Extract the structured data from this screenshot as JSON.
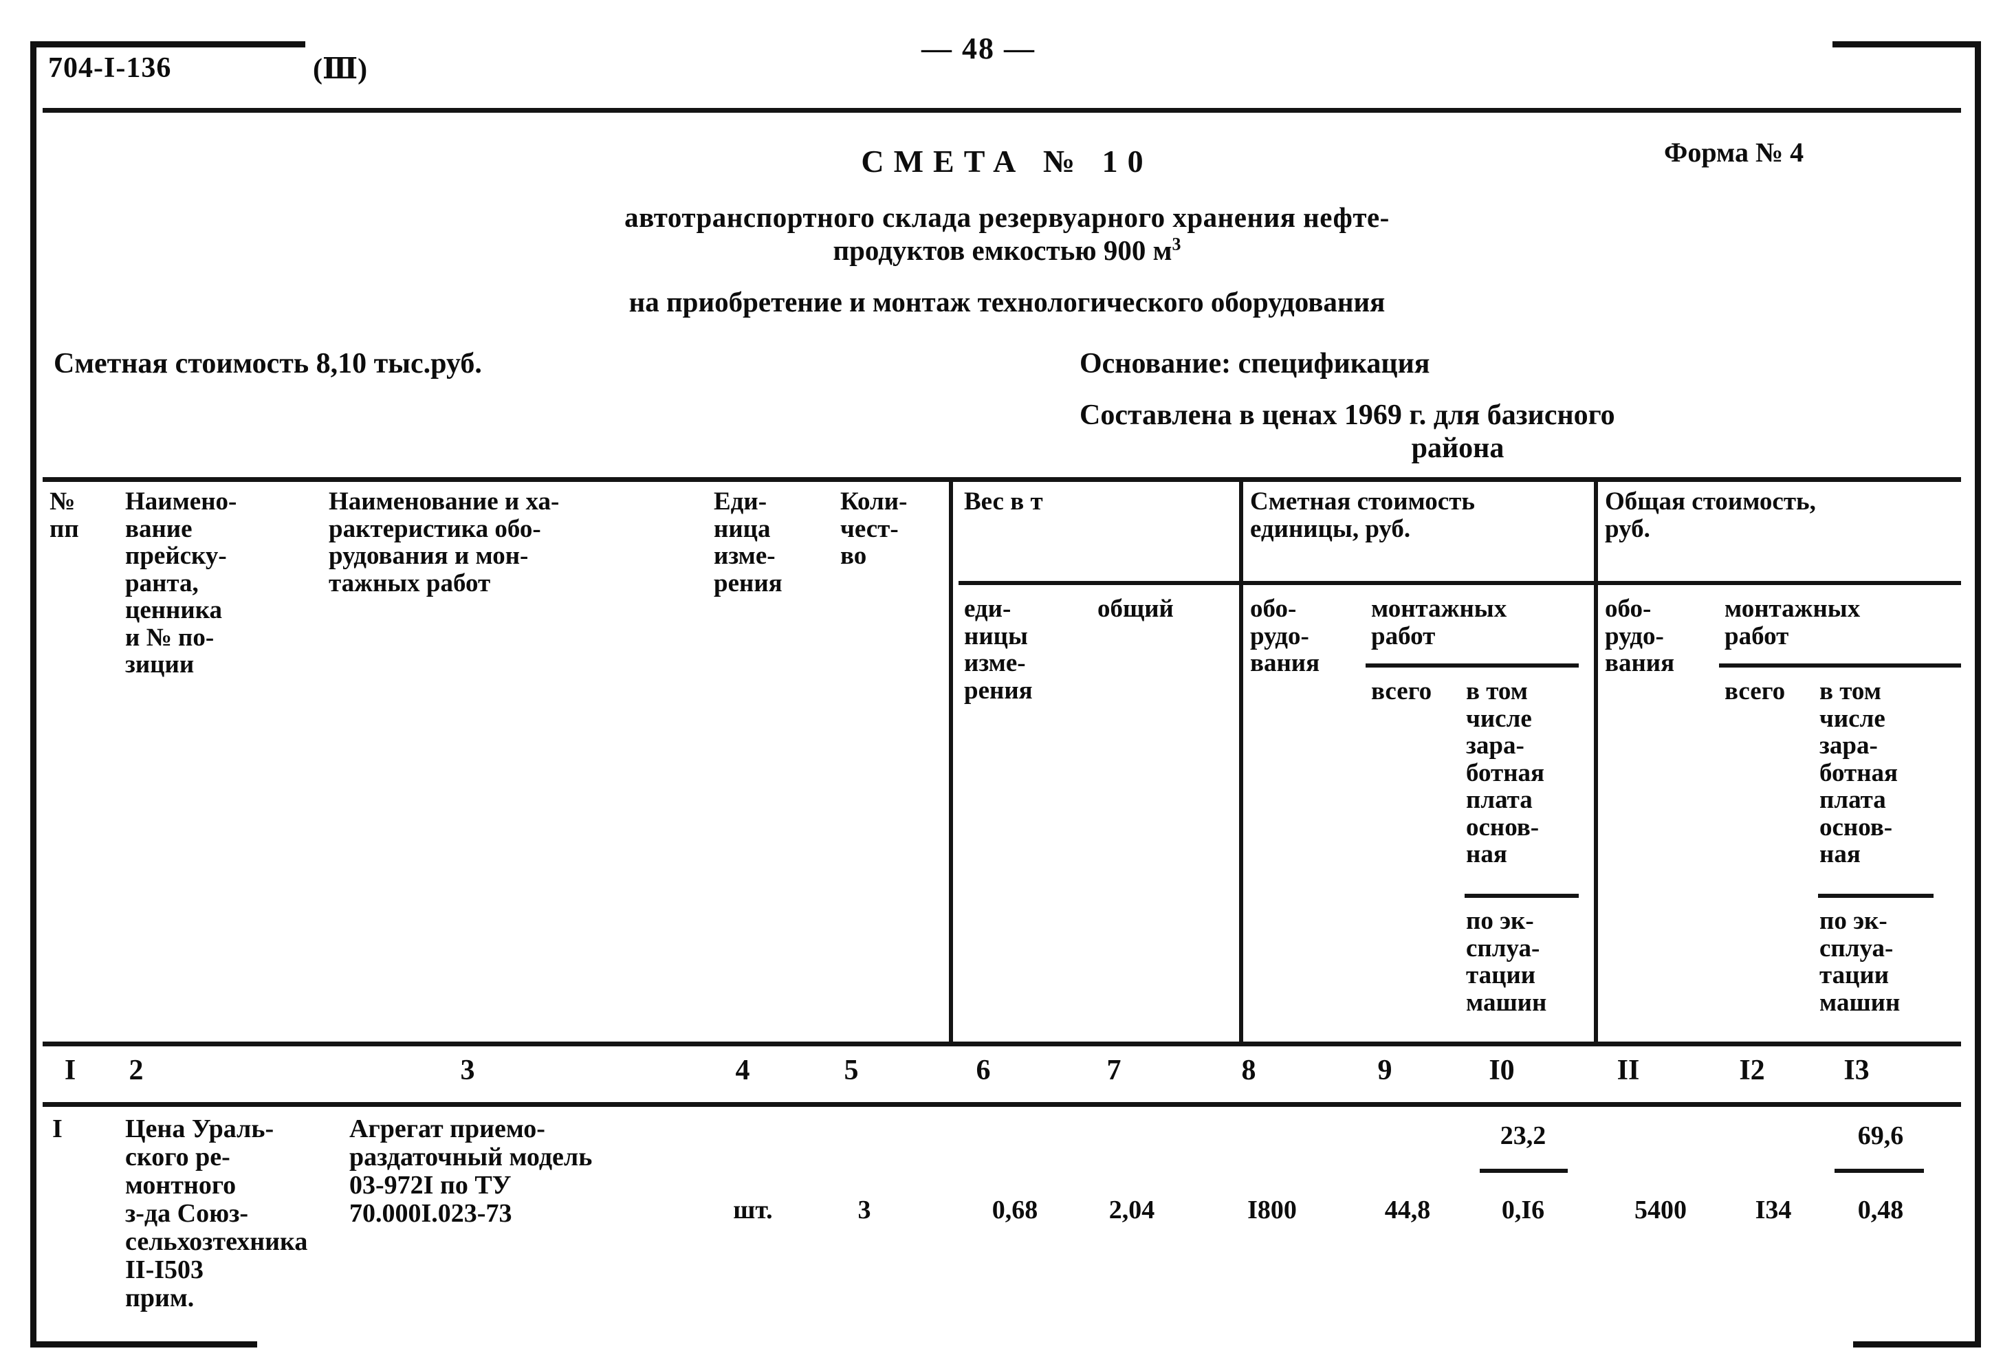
{
  "page": {
    "doc_code": "704-I-136",
    "doc_variant": "(Ⅲ)",
    "page_number": "— 48 —",
    "form_number": "Форма № 4"
  },
  "title": {
    "main": "СМЕТА № 10",
    "subtitle_line1": "автотранспортного склада резервуарного хранения нефте-",
    "subtitle_line2_pre": "продуктов емкостью 900 м",
    "subtitle_line2_sup": "3",
    "subtitle_line3": "на приобретение и монтаж технологического оборудования"
  },
  "summary": {
    "cost_label": "Сметная стоимость 8,10 тыс.руб.",
    "basis_label": "Основание: спецификация",
    "prices_line1": "Составлена в ценах 1969 г. для базисного",
    "prices_line2": "района"
  },
  "table": {
    "headers": {
      "c1": "№\nпп",
      "c2": "Наимено-\nвание\nпрейску-\nранта,\nценника\nи № по-\nзиции",
      "c3": "Наименование и ха-\nрактеристика обо-\nрудования и мон-\nтажных работ",
      "c4": "Еди-\nница\nизме-\nрения",
      "c5": "Коли-\nчест-\nво",
      "g_weight": "Вес в т",
      "c6": "еди-\nницы\nизме-\nрения",
      "c7": "общий",
      "g_unit_cost": "Сметная стоимость\nединицы, руб.",
      "c8": "обо-\nрудо-\nвания",
      "c9_10_group": "монтажных\nработ",
      "c9": "всего",
      "c10": "в том\nчисле\nзара-\nботная\nплата\nоснов-\nная",
      "c10b": "по эк-\nсплуа-\nтации\nмашин",
      "g_total_cost": "Общая стоимость,\nруб.",
      "c11": "обо-\nрудо-\nвания",
      "c12_13_group": "монтажных\nработ",
      "c12": "всего",
      "c13": "в том\nчисле\nзара-\nботная\nплата\nоснов-\nная",
      "c13b": "по эк-\nсплуа-\nтации\nмашин"
    },
    "column_numbers": [
      "I",
      "2",
      "3",
      "4",
      "5",
      "6",
      "7",
      "8",
      "9",
      "I0",
      "II",
      "I2",
      "I3"
    ],
    "rows": [
      {
        "c1": "I",
        "c2": "Цена Ураль-\nского ре-\nмонтного\nз-да Союз-\nсельхозтехника\nII-I503\nприм.",
        "c3": "Агрегат приемо-\nраздаточный модель\n03-972I по ТУ\n70.000I.023-73",
        "c4": "шт.",
        "c5": "3",
        "c6": "0,68",
        "c7": "2,04",
        "c8": "I800",
        "c9": "44,8",
        "c10_top": "23,2",
        "c10_bottom": "0,I6",
        "c11": "5400",
        "c12": "I34",
        "c13_top": "69,6",
        "c13_bottom": "0,48"
      }
    ]
  }
}
